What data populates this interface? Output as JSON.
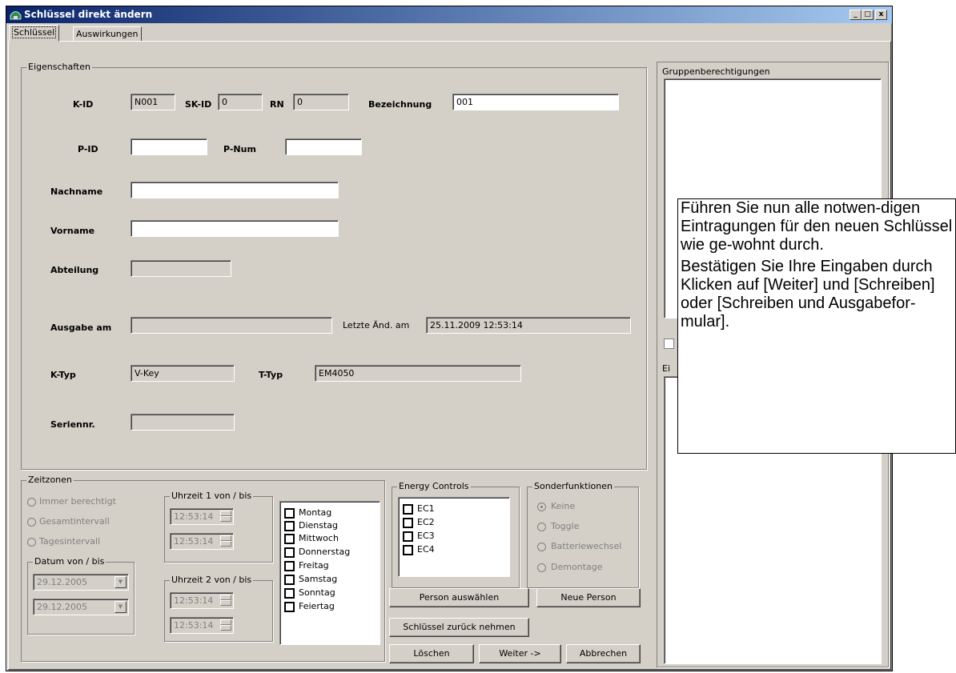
{
  "window": {
    "title": "Schlüssel direkt ändern",
    "controls": {
      "minimize": "_",
      "maximize": "□",
      "close": "x"
    }
  },
  "tabs": [
    {
      "label": "Schlüssel",
      "active": true
    },
    {
      "label": "Auswirkungen",
      "active": false
    }
  ],
  "eigenschaften": {
    "legend": "Eigenschaften",
    "kid_label": "K-ID",
    "kid_value": "N001",
    "skid_label": "SK-ID",
    "skid_value": "0",
    "rn_label": "RN",
    "rn_value": "0",
    "bezeichnung_label": "Bezeichnung",
    "bezeichnung_value": "001",
    "pid_label": "P-ID",
    "pid_value": "",
    "pnum_label": "P-Num",
    "pnum_value": "",
    "nachname_label": "Nachname",
    "nachname_value": "",
    "vorname_label": "Vorname",
    "vorname_value": "",
    "abteilung_label": "Abteilung",
    "abteilung_value": "",
    "ausgabe_label": "Ausgabe am",
    "ausgabe_value": "",
    "letzte_label": "Letzte Änd. am",
    "letzte_value": "25.11.2009 12:53:14",
    "ktyp_label": "K-Typ",
    "ktyp_value": "V-Key",
    "ttyp_label": "T-Typ",
    "ttyp_value": "EM4050",
    "seriennr_label": "Seriennr.",
    "seriennr_value": ""
  },
  "zeitzonen": {
    "legend": "Zeitzonen",
    "options": [
      "Immer berechtigt",
      "Gesamtintervall",
      "Tagesintervall"
    ],
    "datum_legend": "Datum von / bis",
    "datum_von": "29.12.2005",
    "datum_bis": "29.12.2005",
    "uhrzeit1_legend": "Uhrzeit 1 von / bis",
    "uhrzeit1_von": "12:53:14",
    "uhrzeit1_bis": "12:53:14",
    "uhrzeit2_legend": "Uhrzeit 2 von / bis",
    "uhrzeit2_von": "12:53:14",
    "uhrzeit2_bis": "12:53:14",
    "days": [
      "Montag",
      "Dienstag",
      "Mittwoch",
      "Donnerstag",
      "Freitag",
      "Samstag",
      "Sonntag",
      "Feiertag"
    ]
  },
  "energy_controls": {
    "legend": "Energy Controls",
    "items": [
      "EC1",
      "EC2",
      "EC3",
      "EC4"
    ]
  },
  "sonderfunktionen": {
    "legend": "Sonderfunktionen",
    "options": [
      "Keine",
      "Toggle",
      "Batteriewechsel",
      "Demontage"
    ],
    "selected": "Keine"
  },
  "buttons": {
    "person_auswaehlen": "Person auswählen",
    "neue_person": "Neue Person",
    "schluessel_zurueck": "Schlüssel zurück nehmen",
    "loeschen": "Löschen",
    "weiter": "Weiter ->",
    "abbrechen": "Abbrechen"
  },
  "right_panel": {
    "gruppen_legend": "Gruppenberechtigungen",
    "second_legend_fragment": "Ei"
  },
  "callout": {
    "paragraph1": "Führen Sie nun alle notwen-digen Eintragungen für den neuen Schlüssel wie ge-wohnt durch.",
    "paragraph2": "Bestätigen Sie Ihre Eingaben durch Klicken auf [Weiter] und [Schreiben] oder [Schreiben und Ausgabefor-mular]."
  },
  "colors": {
    "titlebar_start": "#0a246a",
    "titlebar_end": "#a6caf0",
    "face": "#d4d0c8"
  }
}
